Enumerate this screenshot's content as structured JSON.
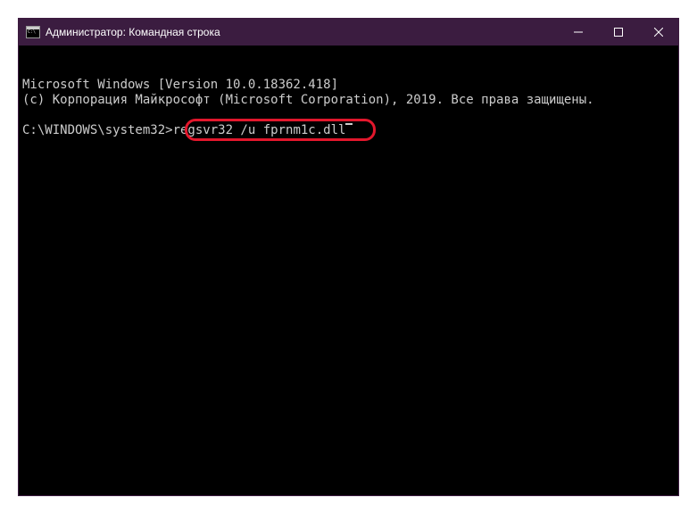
{
  "window": {
    "title": "Администратор: Командная строка"
  },
  "terminal": {
    "line1": "Microsoft Windows [Version 10.0.18362.418]",
    "line2": "(c) Корпорация Майкрософт (Microsoft Corporation), 2019. Все права защищены.",
    "prompt": "C:\\WINDOWS\\system32>",
    "command": "regsvr32 /u fprnm1c.dll"
  }
}
